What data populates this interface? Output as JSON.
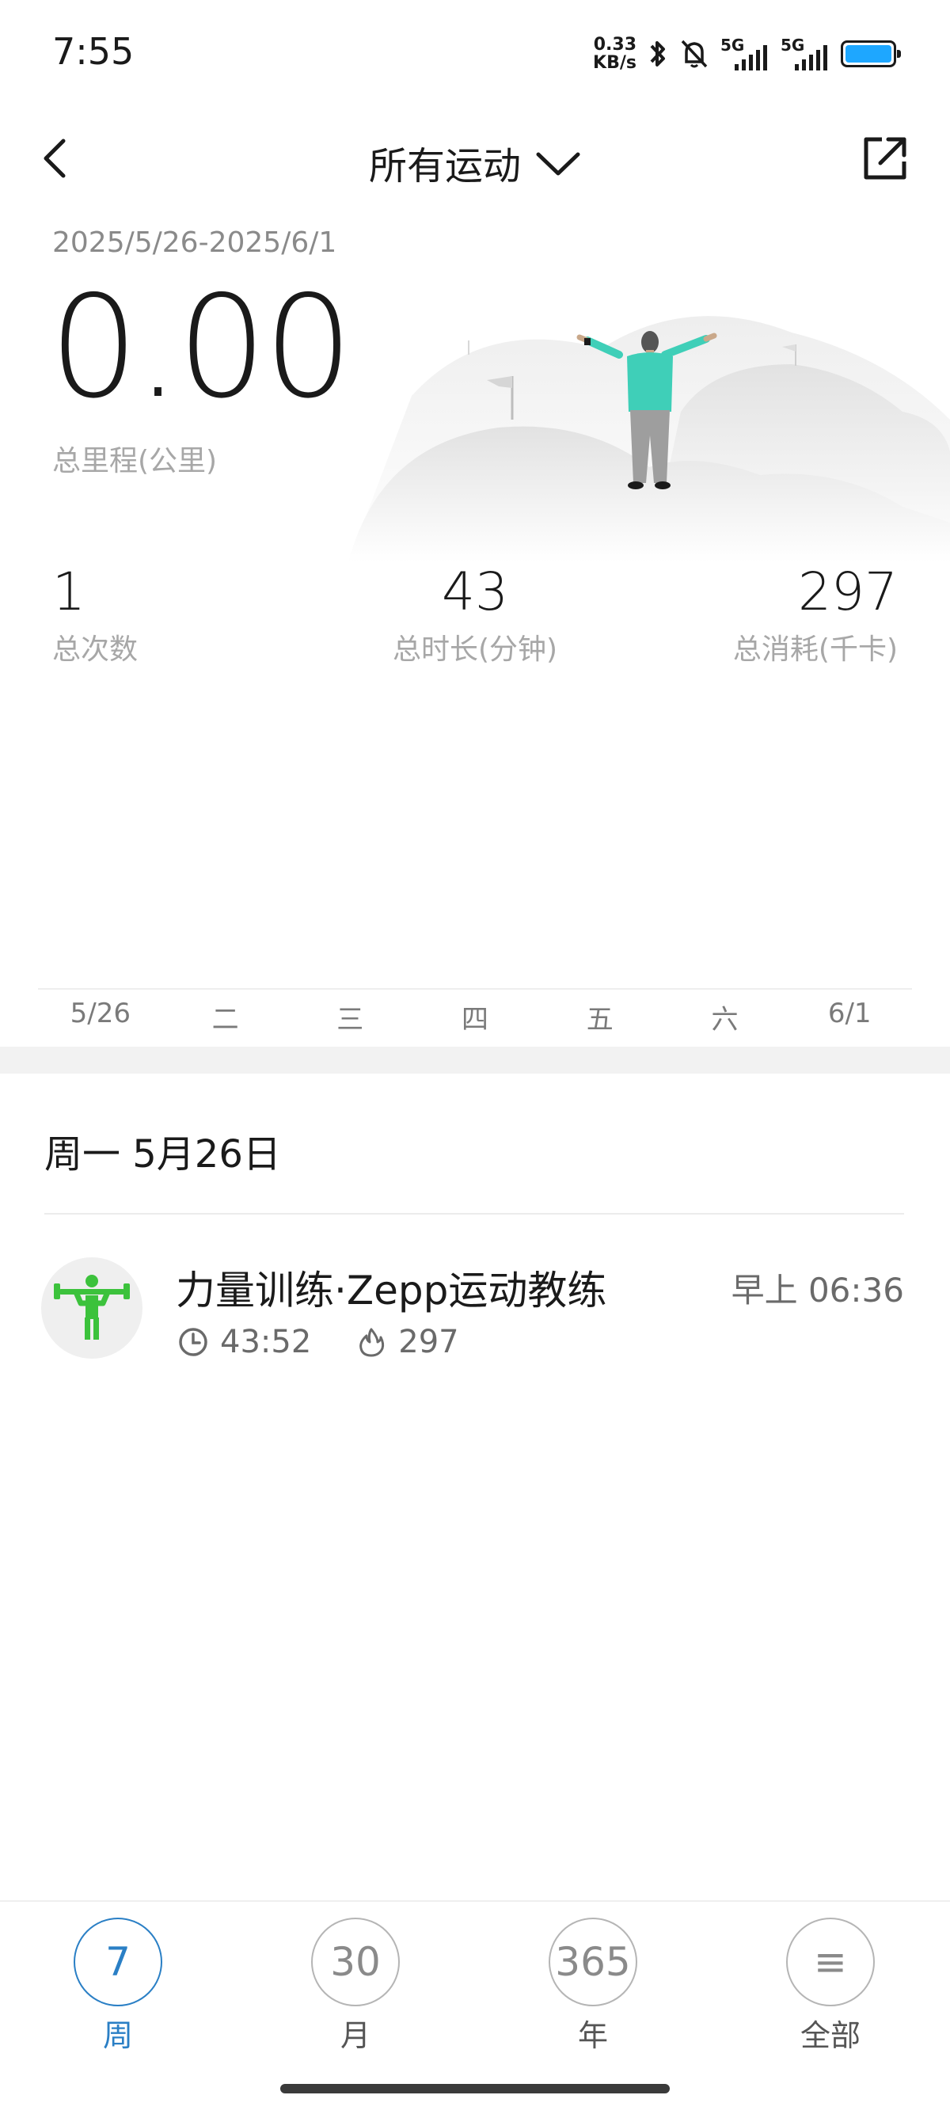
{
  "status_bar": {
    "time": "7:55",
    "net_speed_value": "0.33",
    "net_speed_unit": "KB/s",
    "signal_1_label": "5G",
    "signal_2_label": "5G",
    "battery_color": "#1ea7ff",
    "icons": [
      "bluetooth-icon",
      "bell-off-icon",
      "signal-icon",
      "battery-icon"
    ]
  },
  "header": {
    "title": "所有运动",
    "back_icon": "chevron-left-icon",
    "dropdown_icon": "chevron-down-icon",
    "share_icon": "share-external-icon"
  },
  "summary": {
    "date_range": "2025/5/26-2025/6/1",
    "total_distance": "0.00",
    "total_distance_label": "总里程(公里)"
  },
  "stats": [
    {
      "value": "1",
      "label": "总次数"
    },
    {
      "value": "43",
      "label": "总时长(分钟)"
    },
    {
      "value": "297",
      "label": "总消耗(千卡)"
    }
  ],
  "chart_days": [
    "5/26",
    "二",
    "三",
    "四",
    "五",
    "六",
    "6/1"
  ],
  "day_section": {
    "header": "周一 5月26日"
  },
  "records": [
    {
      "title": "力量训练·Zepp运动教练",
      "time": "早上 06:36",
      "duration": "43:52",
      "calories": "297",
      "icon": "weightlifting-icon",
      "icon_color": "#3cc23c"
    }
  ],
  "bottom_nav": [
    {
      "number": "7",
      "label": "周",
      "active": true
    },
    {
      "number": "30",
      "label": "月",
      "active": false
    },
    {
      "number": "365",
      "label": "年",
      "active": false
    },
    {
      "number": "≡",
      "label": "全部",
      "active": false
    }
  ],
  "colors": {
    "accent": "#2a7fc5",
    "figure_shirt": "#3fcfb8"
  }
}
